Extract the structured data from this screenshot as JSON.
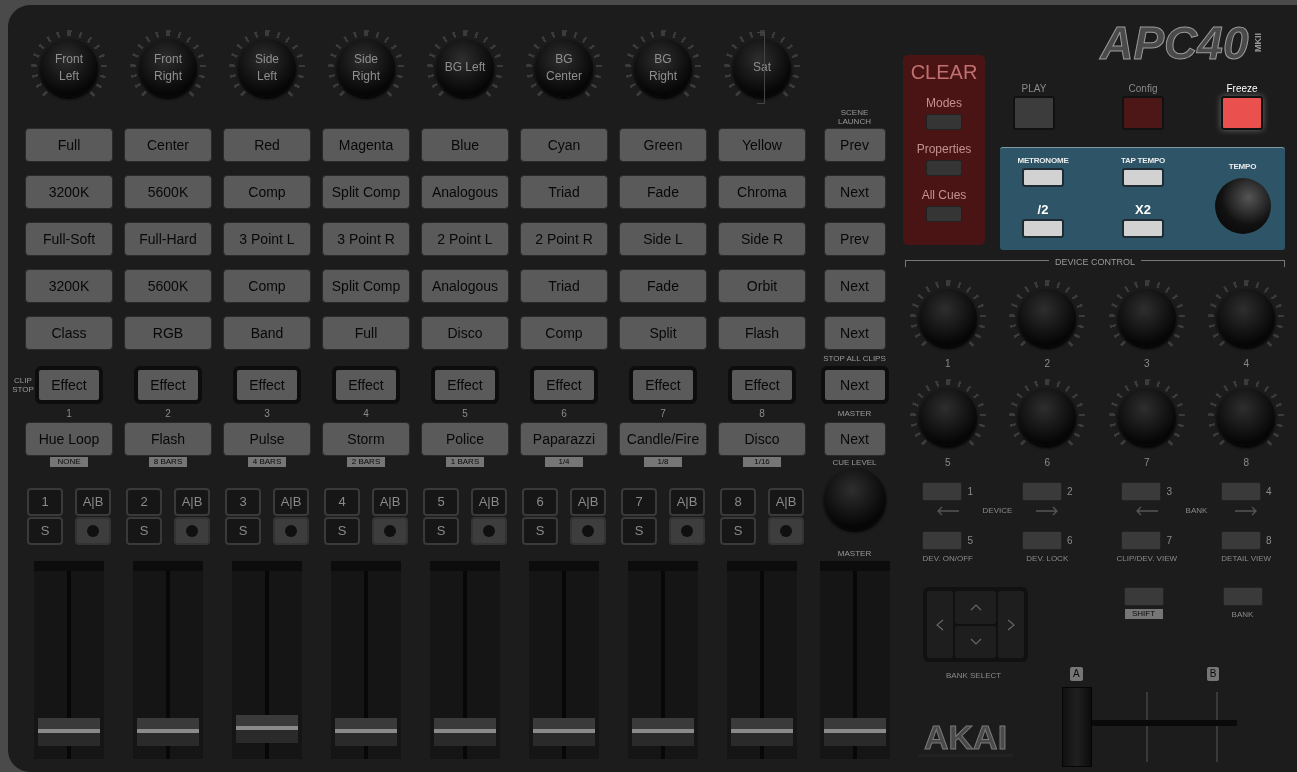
{
  "top_knobs": [
    {
      "label": "Front Left"
    },
    {
      "label": "Front Right"
    },
    {
      "label": "Side Left"
    },
    {
      "label": "Side Right"
    },
    {
      "label": "BG Left"
    },
    {
      "label": "BG Center"
    },
    {
      "label": "BG Right"
    },
    {
      "label": "Sat"
    }
  ],
  "scene_launch_label": "SCENE LAUNCH",
  "clip_rows": [
    {
      "clips": [
        "Full",
        "Center",
        "Red",
        "Magenta",
        "Blue",
        "Cyan",
        "Green",
        "Yellow"
      ],
      "scene": "Prev"
    },
    {
      "clips": [
        "3200K",
        "5600K",
        "Comp",
        "Split Comp",
        "Analogous",
        "Triad",
        "Fade",
        "Chroma"
      ],
      "scene": "Next"
    },
    {
      "clips": [
        "Full-Soft",
        "Full-Hard",
        "3 Point L",
        "3 Point R",
        "2 Point L",
        "2 Point R",
        "Side L",
        "Side R"
      ],
      "scene": "Prev"
    },
    {
      "clips": [
        "3200K",
        "5600K",
        "Comp",
        "Split Comp",
        "Analogous",
        "Triad",
        "Fade",
        "Orbit"
      ],
      "scene": "Next"
    },
    {
      "clips": [
        "Class",
        "RGB",
        "Band",
        "Full",
        "Disco",
        "Comp",
        "Split",
        "Flash"
      ],
      "scene": "Next"
    }
  ],
  "clip_stop": {
    "label": "CLIP STOP",
    "buttons": [
      "Effect",
      "Effect",
      "Effect",
      "Effect",
      "Effect",
      "Effect",
      "Effect",
      "Effect"
    ],
    "stop_all_label": "STOP ALL CLIPS",
    "scene": "Next"
  },
  "tracks": [
    {
      "number": "1",
      "name": "Hue Loop",
      "tag": "NONE",
      "select": "1",
      "ab": "A|B",
      "solo": "S",
      "solo_on": false,
      "armed": true,
      "fader": {
        "level": 0.08
      }
    },
    {
      "number": "2",
      "name": "Flash",
      "tag": "8 BARS",
      "select": "2",
      "ab": "A|B",
      "solo": "S",
      "solo_on": false,
      "armed": true,
      "fader": {
        "level": 0.08
      }
    },
    {
      "number": "3",
      "name": "Pulse",
      "tag": "4 BARS",
      "select": "3",
      "ab": "A|B",
      "solo": "S",
      "solo_on": false,
      "armed": true,
      "fader": {
        "level": 0.1
      }
    },
    {
      "number": "4",
      "name": "Storm",
      "tag": "2 BARS",
      "select": "4",
      "ab": "A|B",
      "solo": "S",
      "solo_on": false,
      "armed": true,
      "fader": {
        "level": 0.08
      }
    },
    {
      "number": "5",
      "name": "Police",
      "tag": "1 BARS",
      "select": "5",
      "ab": "A|B",
      "solo": "S",
      "solo_on": false,
      "armed": true,
      "fader": {
        "level": 0.08
      }
    },
    {
      "number": "6",
      "name": "Paparazzi",
      "tag": "1/4",
      "select": "6",
      "ab": "A|B",
      "solo": "S",
      "solo_on": false,
      "armed": true,
      "fader": {
        "level": 0.08
      }
    },
    {
      "number": "7",
      "name": "Candle/Fire",
      "tag": "1/8",
      "select": "7",
      "ab": "A|B",
      "solo": "S",
      "solo_on": false,
      "armed": true,
      "fader": {
        "level": 0.08
      }
    },
    {
      "number": "8",
      "name": "Disco",
      "tag": "1/16",
      "select": "8",
      "ab": "A|B",
      "solo": "S",
      "solo_on": false,
      "armed": true,
      "fader": {
        "level": 0.08
      }
    }
  ],
  "master": {
    "label": "MASTER",
    "button": "Next",
    "cue_label": "CUE LEVEL",
    "fader_label": "MASTER",
    "fader": {
      "level": 0.08
    }
  },
  "logo": {
    "name": "APC40",
    "model": "MKII"
  },
  "clear_panel": {
    "title": "CLEAR",
    "buttons": [
      {
        "label": "Modes"
      },
      {
        "label": "Properties"
      },
      {
        "label": "All Cues"
      }
    ]
  },
  "transport": [
    {
      "label": "PLAY",
      "color": "#3c3c3c",
      "lit": false
    },
    {
      "label": "Config",
      "color": "#4e1717",
      "lit": false
    },
    {
      "label": "Freeze",
      "color": "#ea514e",
      "lit": true
    }
  ],
  "tempo_panel": {
    "top_buttons": [
      {
        "label": "METRONOME"
      },
      {
        "label": "TAP TEMPO"
      }
    ],
    "bottom_buttons": [
      {
        "label": "/2"
      },
      {
        "label": "X2"
      }
    ],
    "knob_label": "TEMPO"
  },
  "device_control": {
    "title": "DEVICE CONTROL",
    "knobs": [
      "1",
      "2",
      "3",
      "4",
      "5",
      "6",
      "7",
      "8"
    ]
  },
  "device_buttons": [
    {
      "number": "1"
    },
    {
      "number": "2"
    },
    {
      "number": "3"
    },
    {
      "number": "4"
    }
  ],
  "device_nav": [
    {
      "label": "DEVICE"
    },
    {
      "label": "BANK"
    }
  ],
  "device_buttons_2": [
    {
      "number": "5",
      "caption": "DEV. ON/OFF"
    },
    {
      "number": "6",
      "caption": "DEV. LOCK"
    },
    {
      "number": "7",
      "caption": "CLIP/DEV. VIEW"
    },
    {
      "number": "8",
      "caption": "DETAIL VIEW"
    }
  ],
  "bank_select": {
    "label": "BANK SELECT"
  },
  "shift": {
    "label": "SHIFT"
  },
  "bank": {
    "label": "BANK"
  },
  "crossfader": {
    "a": "A",
    "b": "B",
    "level": 0
  },
  "brand": "AKAI"
}
